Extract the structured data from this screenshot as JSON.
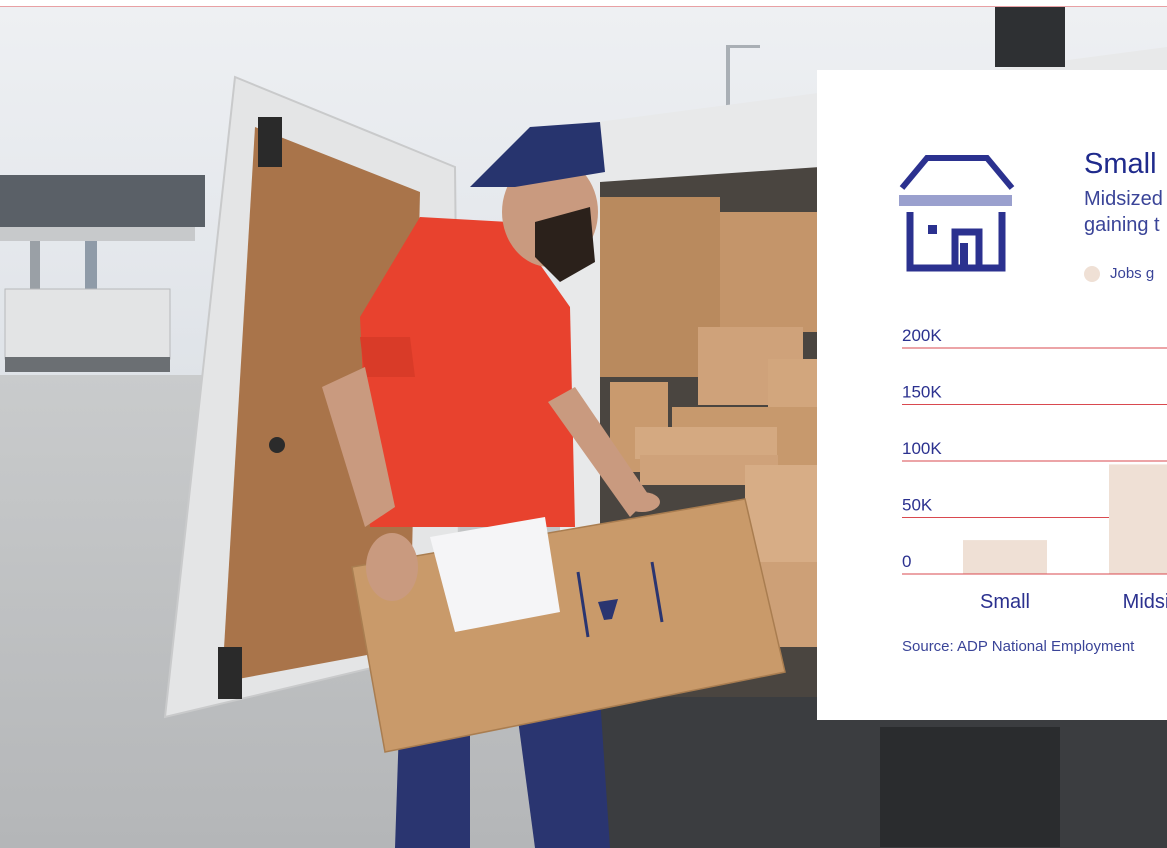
{
  "card": {
    "title": "Small",
    "subtitle_line1": "Midsized",
    "subtitle_line2": "gaining t",
    "source": "Source: ADP National Employment"
  },
  "icon": {
    "name": "storefront-icon"
  },
  "colors": {
    "brand": "#2b318f",
    "bar": "#efe0d5",
    "gridline": "#d9494f",
    "top_rule": "#e8a0a4"
  },
  "chart_data": {
    "type": "bar",
    "categories": [
      "Small",
      "Midsiz"
    ],
    "series": [
      {
        "name": "Jobs g",
        "values": [
          30000,
          97000
        ]
      }
    ],
    "y_ticks": [
      "0",
      "50K",
      "100K",
      "150K",
      "200K"
    ],
    "y_tick_values": [
      0,
      50000,
      100000,
      150000,
      200000
    ],
    "ylim": [
      0,
      200000
    ],
    "grid": true,
    "legend_position": "top-left"
  }
}
